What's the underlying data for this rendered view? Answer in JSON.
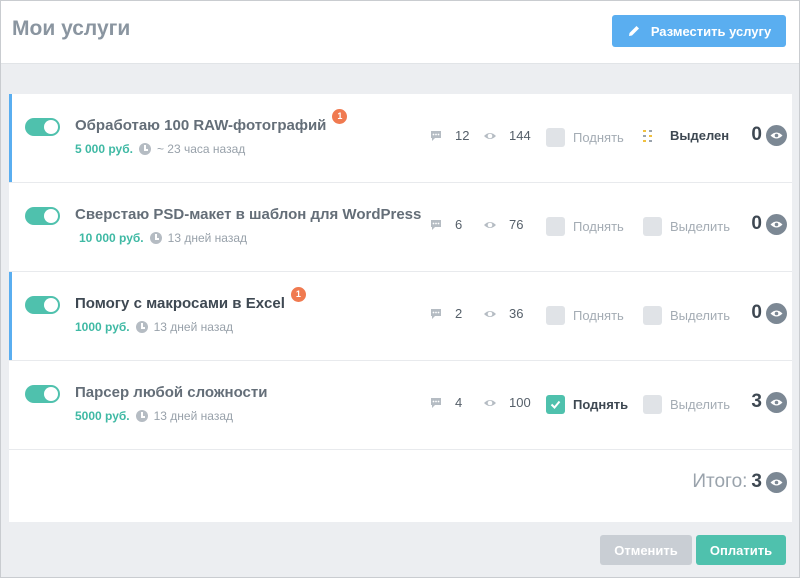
{
  "header": {
    "title": "Мои услуги",
    "add_button": "Разместить услугу"
  },
  "services": [
    {
      "name": "Обработаю 100 RAW-фотографий",
      "badge": "1",
      "price": "5 000 руб.",
      "date": "~ 23 часа назад",
      "comments": "12",
      "views": "144",
      "raise_label": "Поднять",
      "raise_checked": false,
      "highlight_label": "Выделен",
      "highlighted": true,
      "count": "0",
      "enabled": true,
      "active": true
    },
    {
      "name": "Сверстаю PSD-макет в шаблон для WordPress",
      "badge": "",
      "price": "10 000 руб.",
      "date": "13 дней назад",
      "comments": "6",
      "views": "76",
      "raise_label": "Поднять",
      "raise_checked": false,
      "highlight_label": "Выделить",
      "highlighted": false,
      "count": "0",
      "enabled": true,
      "active": false
    },
    {
      "name": "Помогу с макросами в Excel",
      "badge": "1",
      "price": "1000 руб.",
      "date": "13 дней назад",
      "comments": "2",
      "views": "36",
      "raise_label": "Поднять",
      "raise_checked": false,
      "highlight_label": "Выделить",
      "highlighted": false,
      "count": "0",
      "enabled": true,
      "active": true
    },
    {
      "name": "Парсер любой сложности",
      "badge": "",
      "price": "5000 руб.",
      "date": "13 дней назад",
      "comments": "4",
      "views": "100",
      "raise_label": "Поднять",
      "raise_checked": true,
      "highlight_label": "Выделить",
      "highlighted": false,
      "count": "3",
      "enabled": true,
      "active": false
    }
  ],
  "total": {
    "label": "Итого:",
    "value": "3"
  },
  "footer": {
    "cancel": "Отменить",
    "pay": "Оплатить"
  },
  "colors": {
    "accent_blue": "#5aaef0",
    "accent_teal": "#4fc1ad",
    "badge_orange": "#f07a50"
  }
}
